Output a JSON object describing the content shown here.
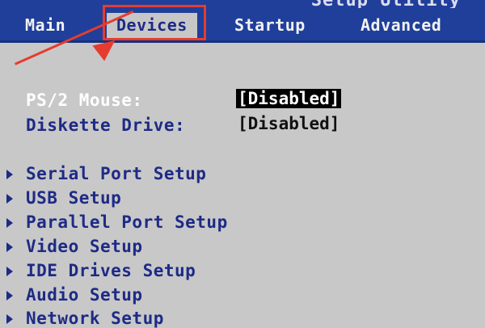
{
  "window": {
    "title": "Setup Utility"
  },
  "tabs": [
    {
      "label": "Main",
      "active": false
    },
    {
      "label": "Devices",
      "active": true
    },
    {
      "label": "Startup",
      "active": false
    },
    {
      "label": "Advanced",
      "active": false
    }
  ],
  "settings": [
    {
      "label": "PS/2 Mouse:",
      "value": "[Disabled]",
      "selected": true
    },
    {
      "label": "Diskette Drive:",
      "value": "[Disabled]",
      "selected": false
    }
  ],
  "submenus": [
    {
      "label": "Serial Port Setup"
    },
    {
      "label": "USB Setup"
    },
    {
      "label": "Parallel Port Setup"
    },
    {
      "label": "Video Setup"
    },
    {
      "label": "IDE Drives Setup"
    },
    {
      "label": "Audio Setup"
    },
    {
      "label": "Network Setup"
    }
  ],
  "colors": {
    "menubar": "#1f3f9a",
    "background": "#c8c8c8",
    "text": "#1d2a86",
    "annotation": "#e53c2f"
  },
  "icons": {
    "submenu": "triangle-right-icon",
    "annotation": "arrow-icon"
  }
}
